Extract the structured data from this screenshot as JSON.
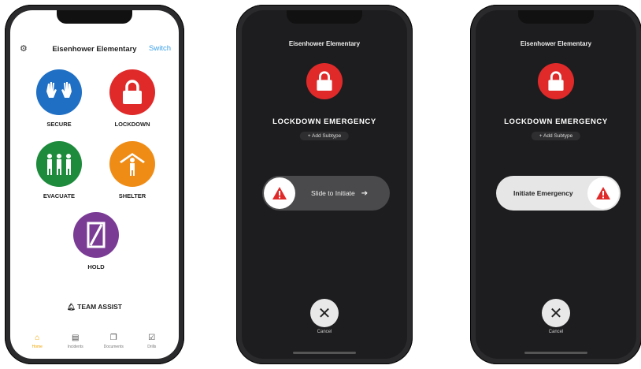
{
  "phone1": {
    "school_name": "Eisenhower Elementary",
    "switch_label": "Switch",
    "actions": {
      "secure": "SECURE",
      "lockdown": "LOCKDOWN",
      "evacuate": "EVACUATE",
      "shelter": "SHELTER",
      "hold": "HOLD"
    },
    "team_assist": "TEAM ASSIST",
    "tabs": [
      "Home",
      "Incidents",
      "Documents",
      "Drills"
    ],
    "colors": {
      "secure": "#1f6fc4",
      "lockdown": "#e02a2a",
      "evacuate": "#1e8a3c",
      "shelter": "#ef8c16",
      "hold": "#7a3b95"
    }
  },
  "phone2": {
    "school_name": "Eisenhower Elementary",
    "emergency_title": "LOCKDOWN EMERGENCY",
    "add_subtype": "+ Add Subtype",
    "slider_label": "Slide to Initiate",
    "cancel_label": "Cancel"
  },
  "phone3": {
    "school_name": "Eisenhower Elementary",
    "emergency_title": "LOCKDOWN EMERGENCY",
    "add_subtype": "+ Add Subtype",
    "slider_label": "Initiate Emergency",
    "cancel_label": "Cancel"
  }
}
